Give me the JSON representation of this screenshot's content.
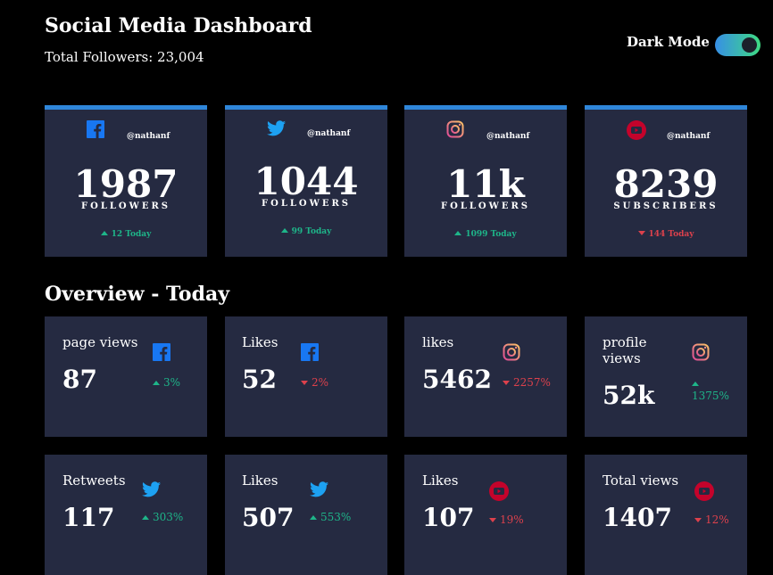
{
  "header": {
    "title": "Social Media Dashboard",
    "total_followers": "Total Followers: 23,004",
    "dark_mode_label": "Dark Mode",
    "dark_mode_on": true
  },
  "colors": {
    "background": "#000000",
    "card": "#252a41",
    "facebook": "#1877f2",
    "twitter": "#1da1f2",
    "instagram": "#e88a6a",
    "youtube": "#c4032b",
    "up": "#1eb589",
    "down": "#dc414c",
    "accent_bar": "#2f86d9"
  },
  "top_cards": [
    {
      "platform": "facebook",
      "icon": "facebook-icon",
      "handle": "@nathanf",
      "count": "1987",
      "unit": "FOLLOWERS",
      "today": "12 Today",
      "trend": "up"
    },
    {
      "platform": "twitter",
      "icon": "twitter-icon",
      "handle": "@nathanf",
      "count": "1044",
      "unit": "FOLLOWERS",
      "today": "99 Today",
      "trend": "up"
    },
    {
      "platform": "instagram",
      "icon": "instagram-icon",
      "handle": "@nathanf",
      "count": "11k",
      "unit": "FOLLOWERS",
      "today": "1099 Today",
      "trend": "up"
    },
    {
      "platform": "youtube",
      "icon": "youtube-icon",
      "handle": "@nathanf",
      "count": "8239",
      "unit": "SUBSCRIBERS",
      "today": "144 Today",
      "trend": "down"
    }
  ],
  "overview": {
    "title": "Overview - Today",
    "cards": [
      {
        "label": "page views",
        "value": "87",
        "pct": "3%",
        "trend": "up",
        "icon": "facebook-icon"
      },
      {
        "label": "Likes",
        "value": "52",
        "pct": "2%",
        "trend": "down",
        "icon": "facebook-icon"
      },
      {
        "label": "likes",
        "value": "5462",
        "pct": "2257%",
        "trend": "down",
        "icon": "instagram-icon"
      },
      {
        "label": "profile views",
        "value": "52k",
        "pct": "1375%",
        "trend": "up",
        "icon": "instagram-icon"
      },
      {
        "label": "Retweets",
        "value": "117",
        "pct": "303%",
        "trend": "up",
        "icon": "twitter-icon"
      },
      {
        "label": "Likes",
        "value": "507",
        "pct": "553%",
        "trend": "up",
        "icon": "twitter-icon"
      },
      {
        "label": "Likes",
        "value": "107",
        "pct": "19%",
        "trend": "down",
        "icon": "youtube-icon"
      },
      {
        "label": "Total views",
        "value": "1407",
        "pct": "12%",
        "trend": "down",
        "icon": "youtube-icon"
      }
    ]
  }
}
